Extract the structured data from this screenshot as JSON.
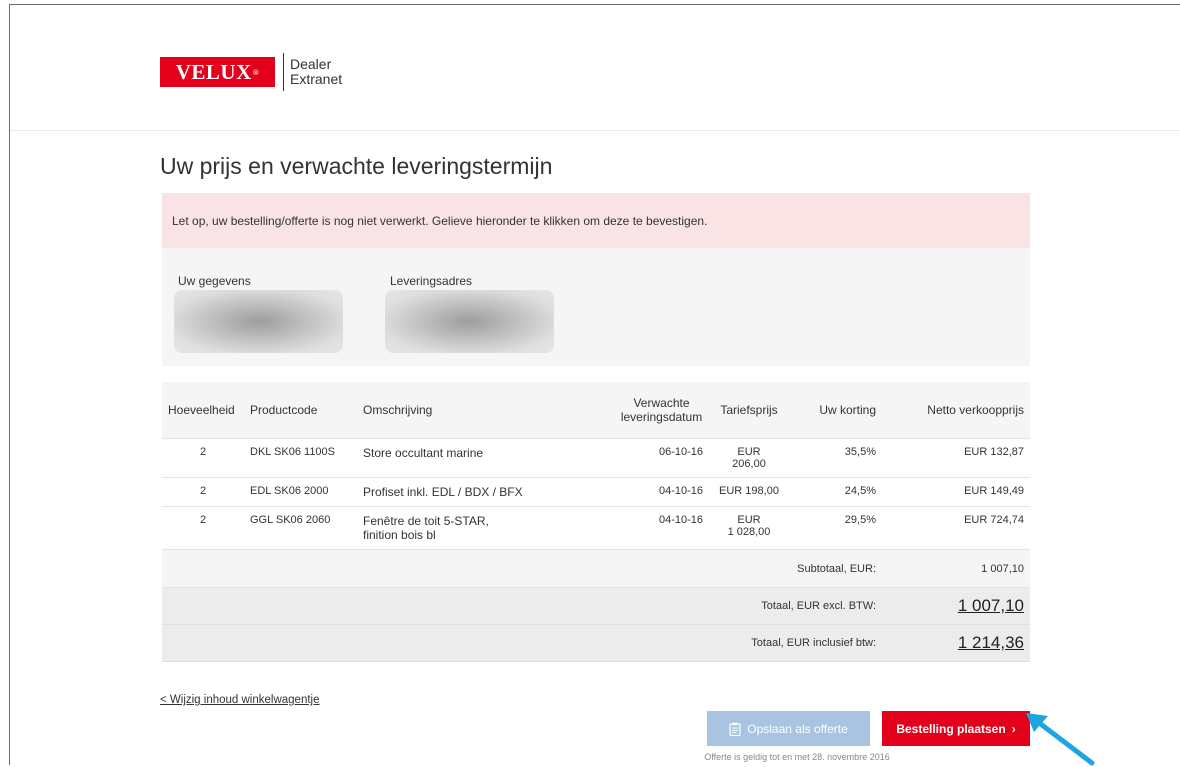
{
  "brand": {
    "logo_text": "VELUX",
    "logo_mark": "®",
    "product_line1": "Dealer",
    "product_line2": "Extranet",
    "accent": "#e2001a"
  },
  "page": {
    "title": "Uw prijs en verwachte leveringstermijn",
    "alert": "Let op, uw bestelling/offerte is nog niet verwerkt. Gelieve hieronder te klikken om deze te bevestigen."
  },
  "info": {
    "customer_label": "Uw gegevens",
    "delivery_label": "Leveringsadres"
  },
  "table": {
    "headers": {
      "qty": "Hoeveelheid",
      "code": "Productcode",
      "desc": "Omschrijving",
      "date_line1": "Verwachte",
      "date_line2": "leveringsdatum",
      "list_price": "Tariefsprijs",
      "discount": "Uw korting",
      "net": "Netto verkoopprijs"
    },
    "rows": [
      {
        "qty": "2",
        "code": "DKL SK06 1100S",
        "desc_line1": "Store occultant marine",
        "desc_line2": "",
        "date": "06-10-16",
        "price_line1": "EUR",
        "price_line2": "206,00",
        "discount": "35,5%",
        "net": "EUR 132,87"
      },
      {
        "qty": "2",
        "code": "EDL SK06 2000",
        "desc_line1": "Profiset inkl. EDL / BDX / BFX",
        "desc_line2": "",
        "date": "04-10-16",
        "price_line1": "EUR 198,00",
        "price_line2": "",
        "discount": "24,5%",
        "net": "EUR 149,49"
      },
      {
        "qty": "2",
        "code": "GGL SK06 2060",
        "desc_line1": "Fenêtre de toit 5-STAR,",
        "desc_line2": "finition bois bl",
        "date": "04-10-16",
        "price_line1": "EUR",
        "price_line2": "1 028,00",
        "discount": "29,5%",
        "net": "EUR 724,74"
      }
    ],
    "subtotal_label": "Subtotaal, EUR:",
    "subtotal_value": "1 007,10",
    "total_excl_label": "Totaal, EUR excl. BTW:",
    "total_excl_value": "1 007,10",
    "total_incl_label": "Totaal, EUR inclusief btw:",
    "total_incl_value": "1 214,36"
  },
  "actions": {
    "back_link": "< Wijzig inhoud winkelwagentje",
    "save_quote": "Opslaan als offerte",
    "place_order": "Bestelling plaatsen",
    "validity": "Offerte is geldig tot en met 28. novembre 2016",
    "save_color": "#a8c4e0",
    "arrow_color": "#1ea5e0"
  }
}
